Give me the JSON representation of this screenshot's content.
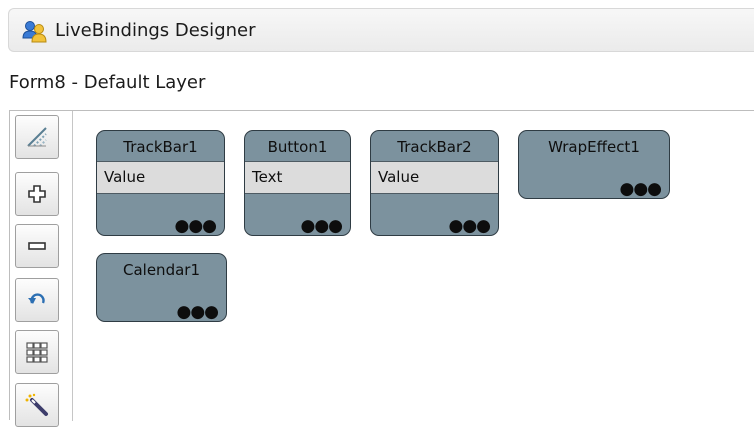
{
  "window": {
    "title": "LiveBindings Designer",
    "icon": "livebindings-people-icon"
  },
  "layer": {
    "label": "Form8  - Default Layer"
  },
  "toolbar": {
    "buttons": [
      {
        "name": "arrange-diagonal-icon"
      },
      {
        "name": "zoom-in-icon"
      },
      {
        "name": "zoom-out-icon"
      },
      {
        "name": "undo-icon"
      },
      {
        "name": "grid-icon"
      },
      {
        "name": "magic-wand-icon"
      }
    ]
  },
  "components": [
    {
      "name": "TrackBar1",
      "property": "Value",
      "more": "●●●"
    },
    {
      "name": "Button1",
      "property": "Text",
      "more": "●●●"
    },
    {
      "name": "TrackBar2",
      "property": "Value",
      "more": "●●●"
    },
    {
      "name": "WrapEffect1",
      "more": "●●●"
    },
    {
      "name": "Calendar1",
      "more": "●●●"
    }
  ],
  "colors": {
    "component_fill": "#7c929e",
    "component_border": "#2f3c44",
    "property_row": "#dcdcdc"
  }
}
